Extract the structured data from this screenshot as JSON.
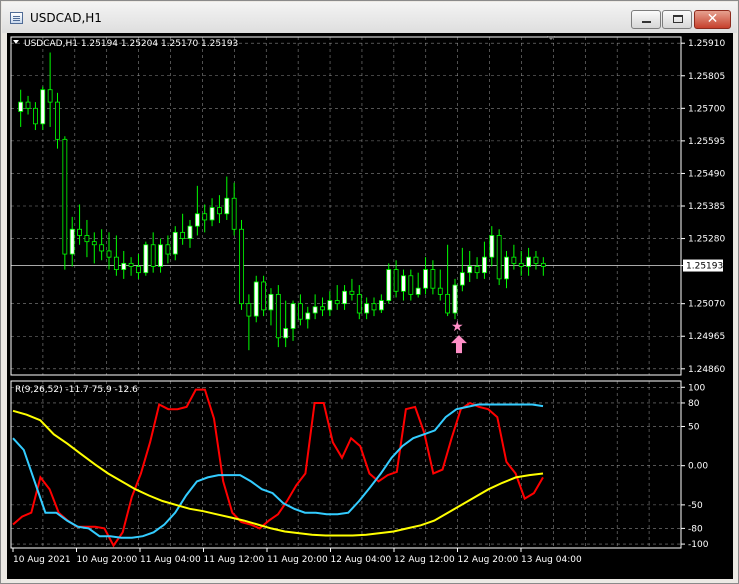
{
  "window": {
    "title": "USDCAD,H1"
  },
  "header": {
    "symbol_line": "USDCAD,H1  1.25194 1.25204 1.25170 1.25193"
  },
  "indicator": {
    "label": "R(9,26,52) -11.7 75.9 -12.6"
  },
  "current_price": "1.25193",
  "colors": {
    "background": "#000000",
    "bull_candle": "#ffffff",
    "bear_candle": "#000000",
    "wick": "#00ff00",
    "grid": "#c0c0c0",
    "line1": "#ff0000",
    "line2": "#33ccff",
    "line3": "#ffff00",
    "marker": "#ff8fc7"
  },
  "chart_data": [
    {
      "type": "candlestick",
      "title": "USDCAD,H1",
      "price_axis_ticks": [
        "1.25910",
        "1.25805",
        "1.25700",
        "1.25595",
        "1.25490",
        "1.25385",
        "1.25280",
        "1.25193",
        "1.25070",
        "1.24965",
        "1.24860"
      ],
      "ylim": [
        1.2484,
        1.2593
      ],
      "grid": true,
      "candles": [
        {
          "o": 1.2569,
          "h": 1.2576,
          "l": 1.2564,
          "c": 1.2572
        },
        {
          "o": 1.2572,
          "h": 1.2574,
          "l": 1.2568,
          "c": 1.257
        },
        {
          "o": 1.257,
          "h": 1.2572,
          "l": 1.2563,
          "c": 1.2565
        },
        {
          "o": 1.2565,
          "h": 1.2577,
          "l": 1.2563,
          "c": 1.2576
        },
        {
          "o": 1.2576,
          "h": 1.2588,
          "l": 1.2564,
          "c": 1.2572
        },
        {
          "o": 1.2572,
          "h": 1.2575,
          "l": 1.2557,
          "c": 1.256
        },
        {
          "o": 1.256,
          "h": 1.2561,
          "l": 1.2518,
          "c": 1.2523
        },
        {
          "o": 1.2523,
          "h": 1.2535,
          "l": 1.2519,
          "c": 1.2531
        },
        {
          "o": 1.2531,
          "h": 1.2539,
          "l": 1.2526,
          "c": 1.2529
        },
        {
          "o": 1.2529,
          "h": 1.2534,
          "l": 1.2522,
          "c": 1.2527
        },
        {
          "o": 1.2527,
          "h": 1.253,
          "l": 1.252,
          "c": 1.2526
        },
        {
          "o": 1.2526,
          "h": 1.2531,
          "l": 1.2521,
          "c": 1.2524
        },
        {
          "o": 1.2524,
          "h": 1.253,
          "l": 1.2518,
          "c": 1.2522
        },
        {
          "o": 1.2522,
          "h": 1.2529,
          "l": 1.2516,
          "c": 1.2518
        },
        {
          "o": 1.2518,
          "h": 1.2524,
          "l": 1.2515,
          "c": 1.252
        },
        {
          "o": 1.252,
          "h": 1.2522,
          "l": 1.2516,
          "c": 1.2519
        },
        {
          "o": 1.2519,
          "h": 1.2523,
          "l": 1.2515,
          "c": 1.2517
        },
        {
          "o": 1.2517,
          "h": 1.2527,
          "l": 1.2516,
          "c": 1.2526
        },
        {
          "o": 1.2526,
          "h": 1.253,
          "l": 1.2517,
          "c": 1.2519
        },
        {
          "o": 1.2519,
          "h": 1.2528,
          "l": 1.2517,
          "c": 1.2526
        },
        {
          "o": 1.2526,
          "h": 1.2529,
          "l": 1.252,
          "c": 1.2523
        },
        {
          "o": 1.2523,
          "h": 1.2532,
          "l": 1.2521,
          "c": 1.253
        },
        {
          "o": 1.253,
          "h": 1.2536,
          "l": 1.2526,
          "c": 1.2528
        },
        {
          "o": 1.2528,
          "h": 1.2534,
          "l": 1.2525,
          "c": 1.2532
        },
        {
          "o": 1.2532,
          "h": 1.2545,
          "l": 1.2529,
          "c": 1.2536
        },
        {
          "o": 1.2536,
          "h": 1.2539,
          "l": 1.253,
          "c": 1.2534
        },
        {
          "o": 1.2534,
          "h": 1.2541,
          "l": 1.2532,
          "c": 1.2538
        },
        {
          "o": 1.2538,
          "h": 1.2542,
          "l": 1.2533,
          "c": 1.2536
        },
        {
          "o": 1.2536,
          "h": 1.2548,
          "l": 1.2534,
          "c": 1.2541
        },
        {
          "o": 1.2541,
          "h": 1.2546,
          "l": 1.2529,
          "c": 1.2531
        },
        {
          "o": 1.2531,
          "h": 1.2534,
          "l": 1.2505,
          "c": 1.2507
        },
        {
          "o": 1.2507,
          "h": 1.251,
          "l": 1.2492,
          "c": 1.2503
        },
        {
          "o": 1.2503,
          "h": 1.2516,
          "l": 1.2501,
          "c": 1.2514
        },
        {
          "o": 1.2514,
          "h": 1.2516,
          "l": 1.2503,
          "c": 1.2505
        },
        {
          "o": 1.2505,
          "h": 1.2512,
          "l": 1.25,
          "c": 1.251
        },
        {
          "o": 1.251,
          "h": 1.2513,
          "l": 1.2493,
          "c": 1.2496
        },
        {
          "o": 1.2496,
          "h": 1.2508,
          "l": 1.2493,
          "c": 1.2499
        },
        {
          "o": 1.2499,
          "h": 1.2508,
          "l": 1.2495,
          "c": 1.2507
        },
        {
          "o": 1.2507,
          "h": 1.251,
          "l": 1.25,
          "c": 1.2502
        },
        {
          "o": 1.2502,
          "h": 1.2506,
          "l": 1.2499,
          "c": 1.2504
        },
        {
          "o": 1.2504,
          "h": 1.251,
          "l": 1.2502,
          "c": 1.2506
        },
        {
          "o": 1.2506,
          "h": 1.2509,
          "l": 1.2503,
          "c": 1.2505
        },
        {
          "o": 1.2505,
          "h": 1.2511,
          "l": 1.2503,
          "c": 1.2508
        },
        {
          "o": 1.2508,
          "h": 1.2513,
          "l": 1.2505,
          "c": 1.2507
        },
        {
          "o": 1.2507,
          "h": 1.2513,
          "l": 1.2505,
          "c": 1.2511
        },
        {
          "o": 1.2511,
          "h": 1.2515,
          "l": 1.2508,
          "c": 1.251
        },
        {
          "o": 1.251,
          "h": 1.2513,
          "l": 1.2502,
          "c": 1.2504
        },
        {
          "o": 1.2504,
          "h": 1.2509,
          "l": 1.2502,
          "c": 1.2507
        },
        {
          "o": 1.2507,
          "h": 1.2509,
          "l": 1.2503,
          "c": 1.2505
        },
        {
          "o": 1.2505,
          "h": 1.251,
          "l": 1.2504,
          "c": 1.2508
        },
        {
          "o": 1.2508,
          "h": 1.252,
          "l": 1.2507,
          "c": 1.2518
        },
        {
          "o": 1.2518,
          "h": 1.2521,
          "l": 1.2509,
          "c": 1.2511
        },
        {
          "o": 1.2511,
          "h": 1.2518,
          "l": 1.2508,
          "c": 1.2516
        },
        {
          "o": 1.2516,
          "h": 1.2518,
          "l": 1.2508,
          "c": 1.251
        },
        {
          "o": 1.251,
          "h": 1.2517,
          "l": 1.2509,
          "c": 1.2512
        },
        {
          "o": 1.2512,
          "h": 1.2522,
          "l": 1.251,
          "c": 1.2518
        },
        {
          "o": 1.2518,
          "h": 1.2521,
          "l": 1.251,
          "c": 1.2512
        },
        {
          "o": 1.2512,
          "h": 1.2518,
          "l": 1.2508,
          "c": 1.251
        },
        {
          "o": 1.251,
          "h": 1.2526,
          "l": 1.2503,
          "c": 1.2504
        },
        {
          "o": 1.2504,
          "h": 1.2515,
          "l": 1.2502,
          "c": 1.2513
        },
        {
          "o": 1.2513,
          "h": 1.2525,
          "l": 1.2511,
          "c": 1.2517
        },
        {
          "o": 1.2517,
          "h": 1.2524,
          "l": 1.2514,
          "c": 1.2519
        },
        {
          "o": 1.2519,
          "h": 1.2522,
          "l": 1.2515,
          "c": 1.2517
        },
        {
          "o": 1.2517,
          "h": 1.2527,
          "l": 1.2515,
          "c": 1.2522
        },
        {
          "o": 1.2522,
          "h": 1.2532,
          "l": 1.2519,
          "c": 1.2529
        },
        {
          "o": 1.2529,
          "h": 1.2531,
          "l": 1.2513,
          "c": 1.2515
        },
        {
          "o": 1.2515,
          "h": 1.2524,
          "l": 1.2512,
          "c": 1.2522
        },
        {
          "o": 1.2522,
          "h": 1.2526,
          "l": 1.2518,
          "c": 1.252
        },
        {
          "o": 1.252,
          "h": 1.2524,
          "l": 1.2516,
          "c": 1.2519
        },
        {
          "o": 1.2519,
          "h": 1.2525,
          "l": 1.2516,
          "c": 1.2522
        },
        {
          "o": 1.2522,
          "h": 1.2524,
          "l": 1.2518,
          "c": 1.252
        },
        {
          "o": 1.252,
          "h": 1.2522,
          "l": 1.2516,
          "c": 1.2519
        }
      ],
      "marker": {
        "type": "up-arrow with star",
        "at_index": 59
      }
    },
    {
      "type": "line",
      "title": "R(9,26,52) -11.7 75.9 -12.6",
      "y_axis_ticks": [
        "100",
        "80",
        "50",
        "0.00",
        "-50",
        "-80",
        "-100"
      ],
      "ylim": [
        -105,
        108
      ],
      "grid": true,
      "x_axis_ticks": [
        "10 Aug 2021",
        "10 Aug 20:00",
        "11 Aug 04:00",
        "11 Aug 12:00",
        "11 Aug 20:00",
        "12 Aug 04:00",
        "12 Aug 12:00",
        "12 Aug 20:00",
        "13 Aug 04:00"
      ],
      "series": [
        {
          "color": "#ff0000",
          "values": [
            -75,
            -65,
            -60,
            -15,
            -30,
            -60,
            -70,
            -78,
            -78,
            -78,
            -80,
            -102,
            -85,
            -40,
            -10,
            30,
            78,
            72,
            72,
            75,
            97,
            97,
            60,
            -20,
            -60,
            -72,
            -75,
            -80,
            -70,
            -62,
            -45,
            -25,
            -10,
            80,
            80,
            30,
            10,
            35,
            25,
            -10,
            -20,
            -12,
            -8,
            72,
            75,
            42,
            -10,
            -5,
            35,
            72,
            80,
            75,
            72,
            62,
            5,
            -10,
            -42,
            -35,
            -15
          ]
        },
        {
          "color": "#33ccff",
          "values": [
            35,
            20,
            -20,
            -60,
            -60,
            -70,
            -78,
            -80,
            -90,
            -90,
            -92,
            -92,
            -90,
            -85,
            -75,
            -60,
            -38,
            -20,
            -15,
            -12,
            -12,
            -12,
            -20,
            -30,
            -35,
            -48,
            -55,
            -60,
            -60,
            -62,
            -62,
            -60,
            -45,
            -28,
            -10,
            10,
            25,
            35,
            40,
            45,
            62,
            72,
            75,
            78,
            78,
            78,
            78,
            78,
            78,
            76
          ]
        },
        {
          "color": "#ffff00",
          "values": [
            70,
            65,
            58,
            40,
            28,
            15,
            2,
            -10,
            -20,
            -30,
            -38,
            -45,
            -50,
            -55,
            -58,
            -62,
            -66,
            -70,
            -75,
            -80,
            -84,
            -86,
            -88,
            -89,
            -89,
            -89,
            -88,
            -86,
            -84,
            -80,
            -76,
            -70,
            -60,
            -50,
            -40,
            -30,
            -22,
            -15,
            -12,
            -10
          ]
        }
      ]
    }
  ]
}
